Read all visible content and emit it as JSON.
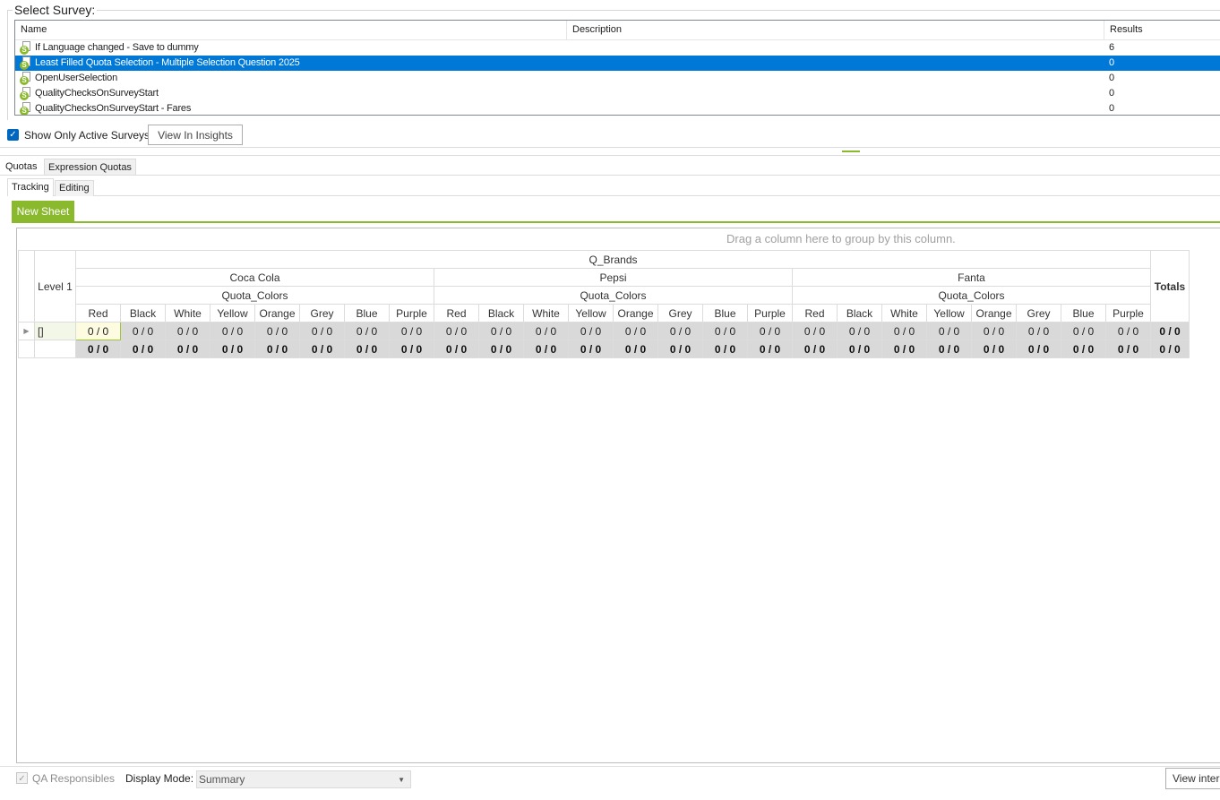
{
  "survey_section": {
    "title": "Select Survey:",
    "columns": {
      "name": "Name",
      "description": "Description",
      "results": "Results"
    },
    "rows": [
      {
        "name": "If Language changed - Save to dummy",
        "results": "6",
        "selected": false
      },
      {
        "name": "Least Filled Quota Selection - Multiple Selection Question 2025",
        "results": "0",
        "selected": true
      },
      {
        "name": "OpenUserSelection",
        "results": "0",
        "selected": false
      },
      {
        "name": "QualityChecksOnSurveyStart",
        "results": "0",
        "selected": false
      },
      {
        "name": "QualityChecksOnSurveyStart - Fares",
        "results": "0",
        "selected": false
      }
    ],
    "icon": "survey-doc-icon",
    "icon_glyph": "S"
  },
  "active_surveys": {
    "label": "Show Only Active Surveys",
    "checked": true,
    "check_glyph": "✓"
  },
  "insights_button": "View In Insights",
  "tabs": {
    "quotas": "Quotas",
    "expression_quotas": "Expression Quotas",
    "tracking": "Tracking",
    "editing": "Editing"
  },
  "sheet_tab": "New Sheet",
  "grid": {
    "group_hint": "Drag a column here to group by this column.",
    "level_header": "Level 1",
    "top_header": "Q_Brands",
    "color_group": "Quota_Colors",
    "brands": [
      "Coca Cola",
      "Pepsi",
      "Fanta"
    ],
    "colors": [
      "Red",
      "Black",
      "White",
      "Yellow",
      "Orange",
      "Grey",
      "Blue",
      "Purple"
    ],
    "totals_header": "Totals",
    "row_label": "[]",
    "cell_value": "0 / 0",
    "total_value": "0 / 0",
    "expand_glyph": "▶"
  },
  "bottom": {
    "qa_label": "QA Responsibles",
    "display_label": "Display Mode:",
    "display_value": "Summary",
    "view_button": "View inter"
  },
  "colors": {
    "accent": "#8bb92e",
    "selection": "#0078d7",
    "cell_bg": "#d9d9d9"
  }
}
